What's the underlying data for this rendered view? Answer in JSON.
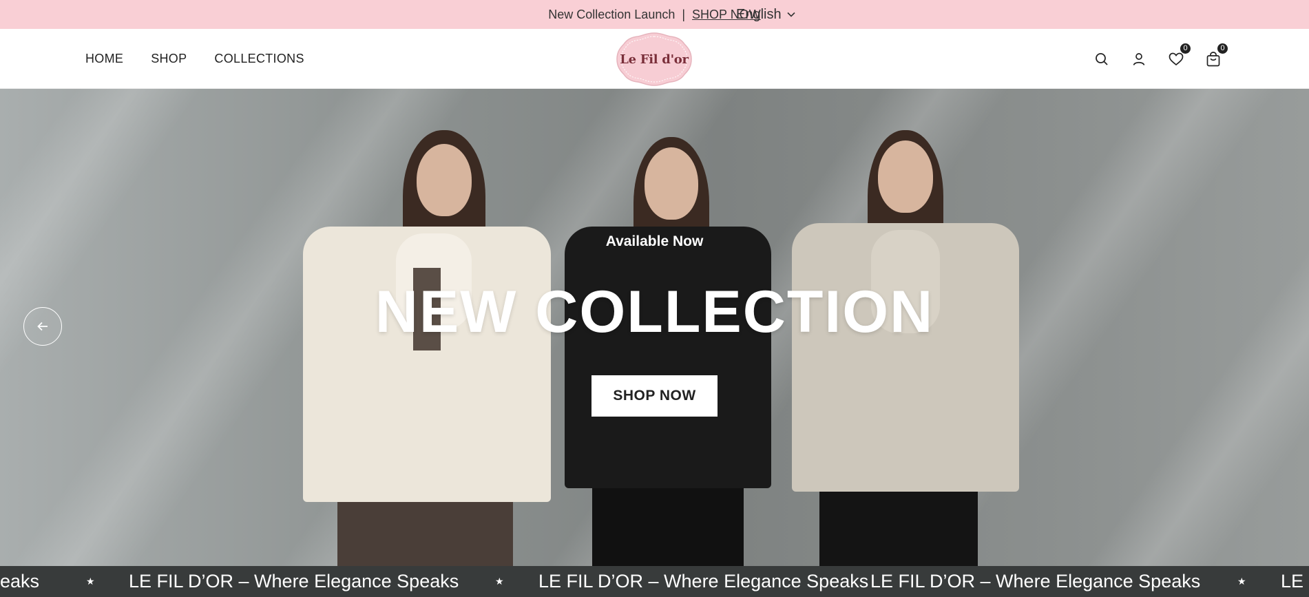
{
  "announcement": {
    "text": "New Collection Launch",
    "separator": "|",
    "link_label": "SHOP NOW",
    "language": "English"
  },
  "nav": {
    "items": [
      {
        "label": "HOME"
      },
      {
        "label": "SHOP"
      },
      {
        "label": "COLLECTIONS"
      }
    ]
  },
  "logo": {
    "text": "Le Fil d'or",
    "bg_color": "#f7cdd4",
    "text_color": "#7a2f3a"
  },
  "header_icons": {
    "search": "search-icon",
    "account": "user-icon",
    "wishlist": "heart-icon",
    "wishlist_count": "0",
    "cart": "bag-icon",
    "cart_count": "0"
  },
  "hero": {
    "subtitle": "Available Now",
    "title": "NEW COLLECTION",
    "button_label": "SHOP NOW",
    "prev_icon": "arrow-left-icon"
  },
  "marquee": {
    "items": [
      "eaks",
      "LE FIL D’OR – Where Elegance Speaks",
      "LE FIL D’OR – Where Elegance Speaks",
      "LE FIL D’OR – Where Elegance Speaks",
      "LE F"
    ],
    "separator": "★"
  },
  "colors": {
    "announcement_bg": "#f9cfd5",
    "marquee_bg": "#383b3b",
    "accent_pink": "#f7cdd4"
  }
}
